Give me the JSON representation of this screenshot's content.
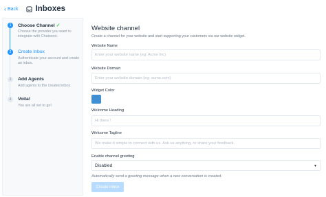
{
  "header": {
    "back_label": "Back",
    "back_icon": "chevron-left-icon",
    "page_icon": "inbox-icon",
    "title": "Inboxes"
  },
  "steps": [
    {
      "title": "Choose Channel",
      "description": "Choose the provider you want to integrate with Chatwoot.",
      "number": "1",
      "state": "done"
    },
    {
      "title": "Create Inbox",
      "description": "Authenticate your account and create an inbox.",
      "number": "2",
      "state": "current"
    },
    {
      "title": "Add Agents",
      "description": "Add agents to the created inbox.",
      "number": "3",
      "state": "todo"
    },
    {
      "title": "Voila!",
      "description": "You are all set to go!",
      "number": "4",
      "state": "todo"
    }
  ],
  "form": {
    "title": "Website channel",
    "subtitle": "Create a channel for your website and start supporting your customers via our website widget.",
    "website_name": {
      "label": "Website Name",
      "placeholder": "Enter your website name (eg: Acme Inc)",
      "value": ""
    },
    "website_domain": {
      "label": "Website Domain",
      "placeholder": "Enter your website domain (eg: acme.com)",
      "value": ""
    },
    "widget_color": {
      "label": "Widget Color",
      "value": "#3f8fd2"
    },
    "welcome_heading": {
      "label": "Welcome Heading",
      "placeholder": "Hi there !",
      "value": ""
    },
    "welcome_tagline": {
      "label": "Welcome Tagline",
      "placeholder": "We make it simple to connect with us. Ask us anything, or share your feedback.",
      "value": ""
    },
    "greeting": {
      "label": "Enable channel greeting",
      "selected": "Disabled",
      "hint": "Automatically send a greeting message when a new conversation is created."
    },
    "submit_label": "Create inbox"
  },
  "colors": {
    "accent": "#1f93ff",
    "success": "#44ce4b",
    "submit_disabled": "#b8dcff"
  }
}
